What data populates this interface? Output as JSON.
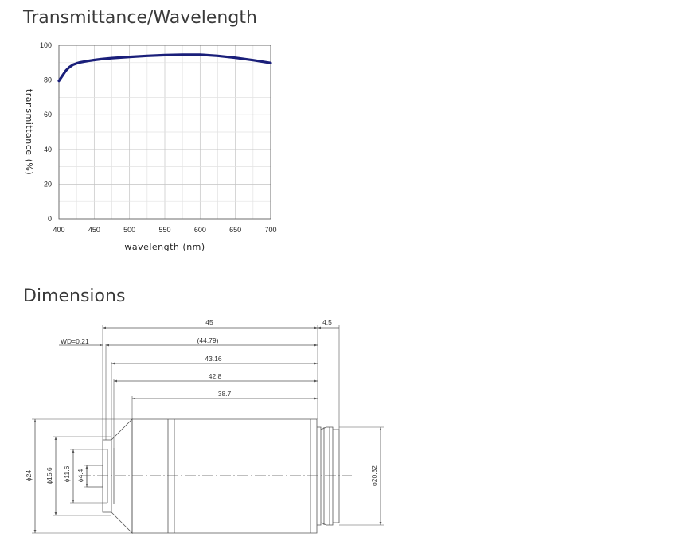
{
  "sections": {
    "transmittance_title": "Transmittance/Wavelength",
    "dimensions_title": "Dimensions"
  },
  "chart_data": {
    "type": "line",
    "title": "",
    "xlabel": "wavelength (nm)",
    "ylabel": "transmittance (%)",
    "xlim": [
      400,
      700
    ],
    "ylim": [
      0,
      100
    ],
    "x_ticks": [
      400,
      450,
      500,
      550,
      600,
      650,
      700
    ],
    "y_ticks": [
      0,
      20,
      40,
      60,
      80,
      100
    ],
    "grid": true,
    "line_color": "#1a1f7a",
    "series": [
      {
        "x": [
          400,
          405,
          410,
          415,
          420,
          425,
          430,
          440,
          450,
          460,
          475,
          500,
          525,
          550,
          575,
          600,
          625,
          650,
          675,
          700
        ],
        "y": [
          79.5,
          82.5,
          85.5,
          87.5,
          88.8,
          89.6,
          90.2,
          90.9,
          91.5,
          92.0,
          92.6,
          93.3,
          93.9,
          94.3,
          94.6,
          94.6,
          93.9,
          92.8,
          91.4,
          89.8
        ]
      }
    ]
  },
  "dimensions": {
    "length_45": "45",
    "length_4_5": "4.5",
    "wd": "WD=0.21",
    "length_44_79": "(44.79)",
    "length_43_16": "43.16",
    "length_42_8": "42.8",
    "length_38_7": "38.7",
    "dia_24": "ϕ24",
    "dia_15_6": "ϕ15.6",
    "dia_11_6": "ϕ11.6",
    "dia_4_4": "ϕ4.4",
    "dia_20_32": "ϕ20.32"
  }
}
